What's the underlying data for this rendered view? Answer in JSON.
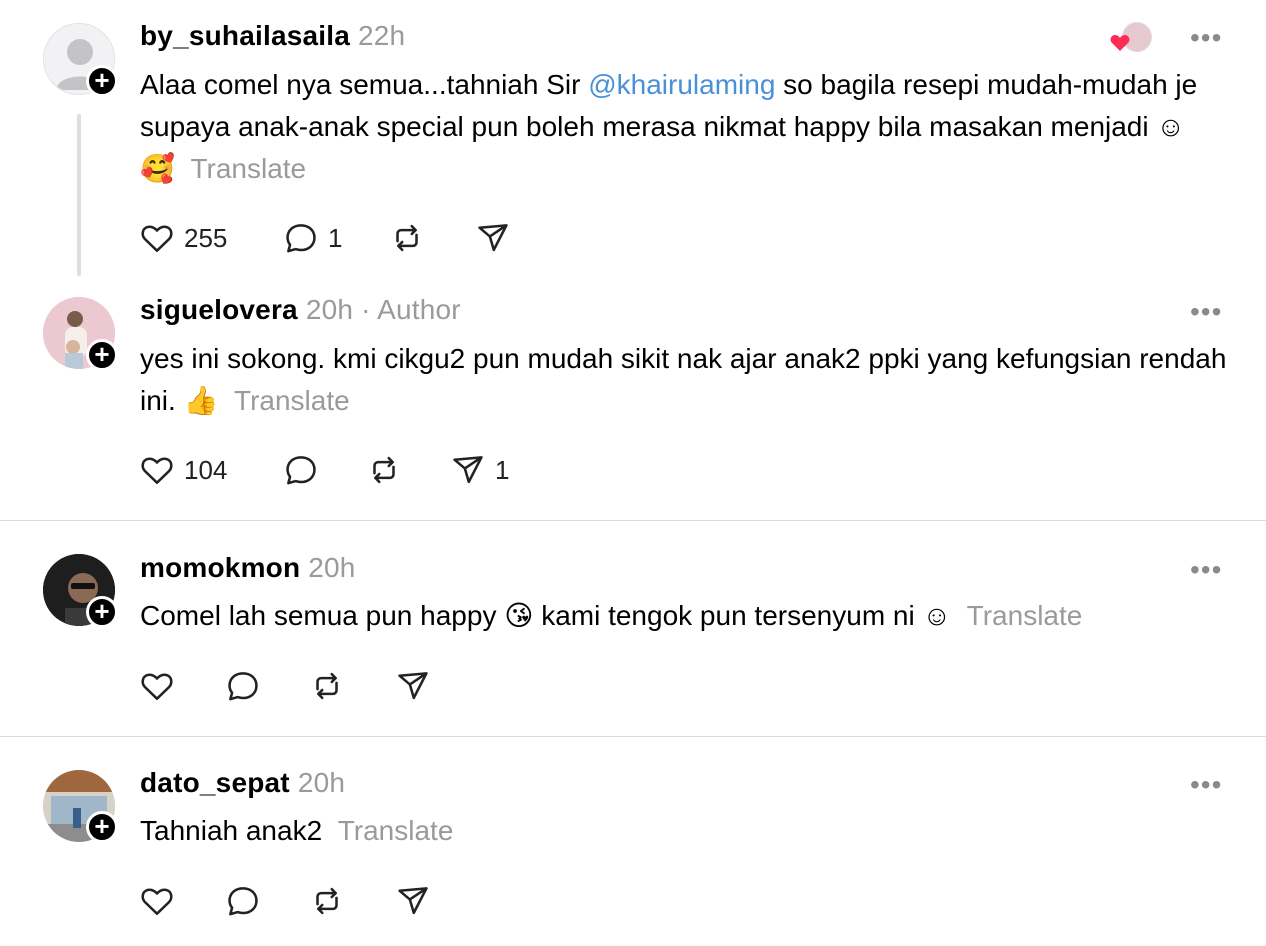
{
  "posts": [
    {
      "username": "by_suhailasaila",
      "time": "22h",
      "author_tag": "",
      "text_before": "Alaa comel nya semua...tahniah Sir ",
      "mention": "@khairulaming",
      "text_after": " so bagila resepi mudah-mudah je supaya anak-anak special pun boleh merasa nikmat happy bila masakan menjadi ☺🥰",
      "translate": "Translate",
      "likes": "255",
      "replies": "1",
      "reposts": "",
      "shares": ""
    },
    {
      "username": "siguelovera",
      "time": "20h",
      "author_tag": "Author",
      "text_before": "yes ini sokong. kmi cikgu2 pun mudah sikit nak ajar anak2 ppki yang kefungsian rendah ini. 👍",
      "mention": "",
      "text_after": "",
      "translate": "Translate",
      "likes": "104",
      "replies": "",
      "reposts": "",
      "shares": "1"
    },
    {
      "username": "momokmon",
      "time": "20h",
      "author_tag": "",
      "text_before": "Comel lah semua pun happy 😘 kami tengok pun tersenyum ni ☺",
      "mention": "",
      "text_after": "",
      "translate": "Translate",
      "likes": "",
      "replies": "",
      "reposts": "",
      "shares": ""
    },
    {
      "username": "dato_sepat",
      "time": "20h",
      "author_tag": "",
      "text_before": "Tahniah anak2",
      "mention": "",
      "text_after": "",
      "translate": "Translate",
      "likes": "",
      "replies": "",
      "reposts": "",
      "shares": ""
    }
  ],
  "icons": {
    "like": "heart-icon",
    "reply": "comment-icon",
    "repost": "repost-icon",
    "share": "send-icon",
    "more": "more-icon",
    "follow": "plus-icon"
  },
  "colors": {
    "mention": "#4a90d9",
    "muted": "#9a9a9a",
    "heart_badge": "#ff2d55"
  }
}
